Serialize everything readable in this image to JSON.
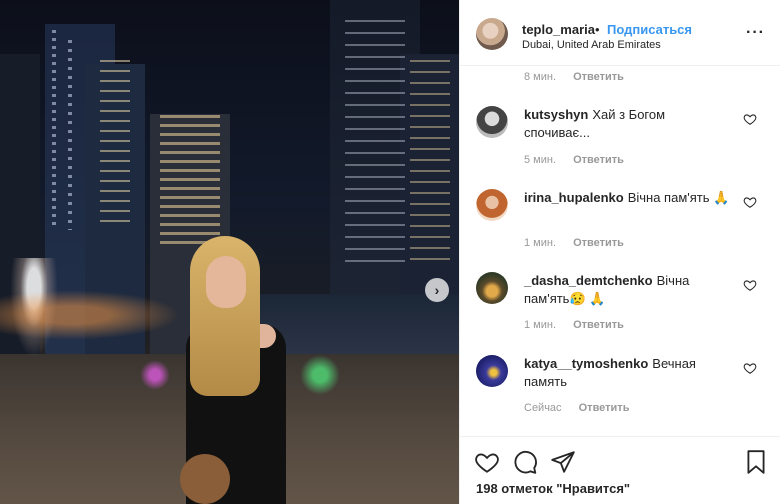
{
  "post": {
    "username": "teplo_maria",
    "separator": "•",
    "follow_label": "Подписаться",
    "location": "Dubai, United Arab Emirates",
    "more_icon": "more-options-icon"
  },
  "comments": {
    "first_meta": {
      "time": "8 мин.",
      "reply": "Ответить"
    },
    "items": [
      {
        "user": "kutsyshyn",
        "text": "Хай з Богом спочиває...",
        "time": "5 мин.",
        "reply": "Ответить"
      },
      {
        "user": "irina_hupalenko",
        "text": "Вічна пам'ять 🙏",
        "time": "1 мин.",
        "reply": "Ответить"
      },
      {
        "user": "_dasha_demtchenko",
        "text": "Вічна пам'ять😥 🙏",
        "time": "1 мин.",
        "reply": "Ответить"
      },
      {
        "user": "katya__tymoshenko",
        "text": "Вечная память",
        "time": "Сейчас",
        "reply": "Ответить"
      }
    ]
  },
  "actions": {
    "likes_text": "198 отметок \"Нравится\"",
    "icons": [
      "heart-icon",
      "comment-icon",
      "share-icon",
      "bookmark-icon"
    ]
  },
  "colors": {
    "link_blue": "#3897f0",
    "text": "#262626",
    "muted": "#999999",
    "border": "#efefef"
  }
}
